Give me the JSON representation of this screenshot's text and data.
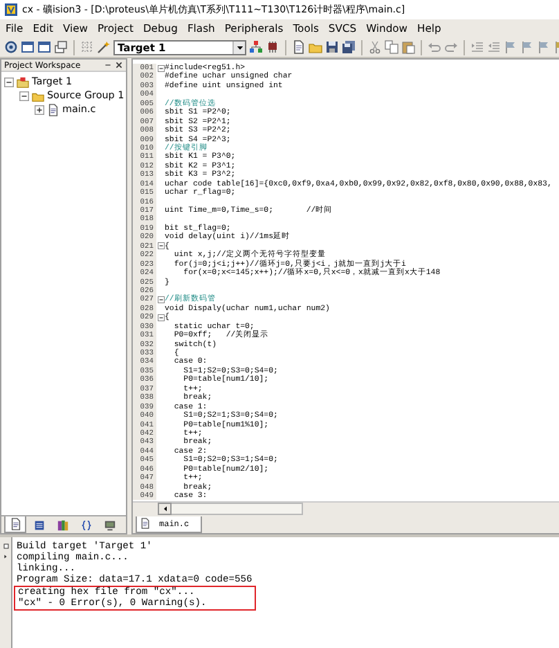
{
  "window": {
    "title": "cx - 礦ision3 - [D:\\proteus\\单片机仿真\\T系列\\T111~T130\\T126计时器\\程序\\main.c]"
  },
  "menu": [
    "File",
    "Edit",
    "View",
    "Project",
    "Debug",
    "Flash",
    "Peripherals",
    "Tools",
    "SVCS",
    "Window",
    "Help"
  ],
  "toolbar": {
    "target": "Target 1"
  },
  "workspace": {
    "title": "Project Workspace",
    "tree": [
      {
        "label": "Target 1",
        "kind": "target",
        "expanded": true,
        "children": [
          {
            "label": "Source Group 1",
            "kind": "group",
            "expanded": true,
            "children": [
              {
                "label": "main.c",
                "kind": "file",
                "expanded": false
              }
            ]
          }
        ]
      }
    ],
    "tabs": [
      {
        "kind": "files",
        "selected": true
      },
      {
        "kind": "registers",
        "selected": false
      },
      {
        "kind": "books",
        "selected": false
      },
      {
        "kind": "functions",
        "selected": false
      },
      {
        "kind": "templates",
        "selected": false
      }
    ]
  },
  "editor": {
    "lines": [
      {
        "number": "001",
        "text": "#include<reg51.h>",
        "kind": "code",
        "fold": true
      },
      {
        "number": "002",
        "text": "#define uchar unsigned char",
        "kind": "code",
        "fold": false
      },
      {
        "number": "003",
        "text": "#define uint unsigned int",
        "kind": "code",
        "fold": false
      },
      {
        "number": "004",
        "fold": false
      },
      {
        "number": "005",
        "text": "//数码管位选",
        "kind": "comment",
        "fold": false
      },
      {
        "number": "006",
        "text": "sbit S1 =P2^0;",
        "kind": "code",
        "fold": false
      },
      {
        "number": "007",
        "text": "sbit S2 =P2^1;",
        "kind": "code",
        "fold": false
      },
      {
        "number": "008",
        "text": "sbit S3 =P2^2;",
        "kind": "code",
        "fold": false
      },
      {
        "number": "009",
        "text": "sbit S4 =P2^3;",
        "kind": "code",
        "fold": false
      },
      {
        "number": "010",
        "text": "//按键引脚",
        "kind": "comment",
        "fold": false
      },
      {
        "number": "011",
        "text": "sbit K1 = P3^0;",
        "kind": "code",
        "fold": false
      },
      {
        "number": "012",
        "text": "sbit K2 = P3^1;",
        "kind": "code",
        "fold": false
      },
      {
        "number": "013",
        "text": "sbit K3 = P3^2;",
        "kind": "code",
        "fold": false
      },
      {
        "number": "014",
        "text": "uchar code table[16]={0xc0,0xf9,0xa4,0xb0,0x99,0x92,0x82,0xf8,0x80,0x90,0x88,0x83,",
        "kind": "code",
        "fold": false
      },
      {
        "number": "015",
        "text": "uchar r_flag=0;",
        "kind": "code",
        "fold": false
      },
      {
        "number": "016",
        "fold": false
      },
      {
        "number": "017",
        "text": "uint Time_m=0,Time_s=0;       //时间",
        "kind": "code",
        "fold": false
      },
      {
        "number": "018",
        "fold": false
      },
      {
        "number": "019",
        "text": "bit st_flag=0;",
        "kind": "code",
        "fold": false
      },
      {
        "number": "020",
        "text": "void delay(uint i)//1ms延时",
        "kind": "code",
        "fold": false
      },
      {
        "number": "021",
        "text": "{",
        "kind": "code",
        "fold": true
      },
      {
        "number": "022",
        "text": "  uint x,j;//定义两个无符号字符型变量",
        "kind": "code",
        "fold": false
      },
      {
        "number": "023",
        "text": "  for(j=0;j<i;j++)//循环j=0,只要j<i，j就加一直到j大于i",
        "kind": "code",
        "fold": false
      },
      {
        "number": "024",
        "text": "    for(x=0;x<=145;x++);//循环x=0,只x<=0，x就减一直到x大于148",
        "kind": "code",
        "fold": false
      },
      {
        "number": "025",
        "text": "}",
        "kind": "code",
        "fold": false
      },
      {
        "number": "026",
        "fold": false
      },
      {
        "number": "027",
        "text": "//刷新数码管",
        "kind": "comment",
        "fold": true
      },
      {
        "number": "028",
        "text": "void Dispaly(uchar num1,uchar num2)",
        "kind": "code",
        "fold": false
      },
      {
        "number": "029",
        "text": "{",
        "kind": "code",
        "fold": true
      },
      {
        "number": "030",
        "text": "  static uchar t=0;",
        "kind": "code",
        "fold": false
      },
      {
        "number": "031",
        "text": "  P0=0xff;   //关闭显示",
        "kind": "code",
        "fold": false
      },
      {
        "number": "032",
        "text": "  switch(t)",
        "kind": "code",
        "fold": false
      },
      {
        "number": "033",
        "text": "  {",
        "kind": "code",
        "fold": false
      },
      {
        "number": "034",
        "text": "  case 0:",
        "kind": "code",
        "fold": false
      },
      {
        "number": "035",
        "text": "    S1=1;S2=0;S3=0;S4=0;",
        "kind": "code",
        "fold": false
      },
      {
        "number": "036",
        "text": "    P0=table[num1/10];",
        "kind": "code",
        "fold": false
      },
      {
        "number": "037",
        "text": "    t++;",
        "kind": "code",
        "fold": false
      },
      {
        "number": "038",
        "text": "    break;",
        "kind": "code",
        "fold": false
      },
      {
        "number": "039",
        "text": "  case 1:",
        "kind": "code",
        "fold": false
      },
      {
        "number": "040",
        "text": "    S1=0;S2=1;S3=0;S4=0;",
        "kind": "code",
        "fold": false
      },
      {
        "number": "041",
        "text": "    P0=table[num1%10];",
        "kind": "code",
        "fold": false
      },
      {
        "number": "042",
        "text": "    t++;",
        "kind": "code",
        "fold": false
      },
      {
        "number": "043",
        "text": "    break;",
        "kind": "code",
        "fold": false
      },
      {
        "number": "044",
        "text": "  case 2:",
        "kind": "code",
        "fold": false
      },
      {
        "number": "045",
        "text": "    S1=0;S2=0;S3=1;S4=0;",
        "kind": "code",
        "fold": false
      },
      {
        "number": "046",
        "text": "    P0=table[num2/10];",
        "kind": "code",
        "fold": false
      },
      {
        "number": "047",
        "text": "    t++;",
        "kind": "code",
        "fold": false
      },
      {
        "number": "048",
        "text": "    break;",
        "kind": "code",
        "fold": false
      },
      {
        "number": "049",
        "text": "  case 3:",
        "kind": "code",
        "fold": false
      }
    ],
    "tabs": [
      {
        "label": "main.c",
        "selected": true
      }
    ]
  },
  "output": {
    "lines": [
      {
        "text": "Build target 'Target 1'",
        "highlighted": false
      },
      {
        "text": "compiling main.c...",
        "highlighted": false
      },
      {
        "text": "linking...",
        "highlighted": false
      },
      {
        "text": "Program Size: data=17.1 xdata=0 code=556",
        "highlighted": false
      },
      {
        "text": "creating hex file from \"cx\"...",
        "highlighted": true
      },
      {
        "text": "\"cx\" - 0 Error(s), 0 Warning(s).",
        "highlighted": true
      }
    ]
  }
}
